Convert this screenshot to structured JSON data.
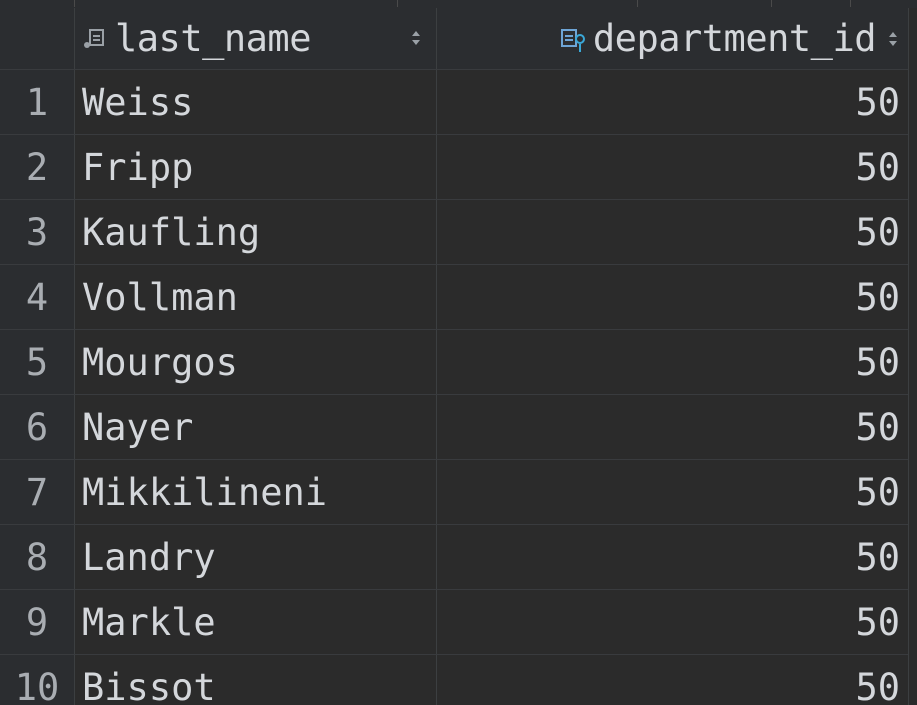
{
  "columns": {
    "last_name": {
      "label": "last_name",
      "icon": "column-icon"
    },
    "department_id": {
      "label": "department_id",
      "icon": "key-column-icon"
    }
  },
  "rows": [
    {
      "num": "1",
      "last_name": "Weiss",
      "department_id": "50"
    },
    {
      "num": "2",
      "last_name": "Fripp",
      "department_id": "50"
    },
    {
      "num": "3",
      "last_name": "Kaufling",
      "department_id": "50"
    },
    {
      "num": "4",
      "last_name": "Vollman",
      "department_id": "50"
    },
    {
      "num": "5",
      "last_name": "Mourgos",
      "department_id": "50"
    },
    {
      "num": "6",
      "last_name": "Nayer",
      "department_id": "50"
    },
    {
      "num": "7",
      "last_name": "Mikkilineni",
      "department_id": "50"
    },
    {
      "num": "8",
      "last_name": "Landry",
      "department_id": "50"
    },
    {
      "num": "9",
      "last_name": "Markle",
      "department_id": "50"
    },
    {
      "num": "10",
      "last_name": "Bissot",
      "department_id": "50"
    }
  ],
  "colors": {
    "background": "#2b2b2b",
    "gutter": "#2b2d30",
    "text": "#d4d7db",
    "key_icon": "#3aa8d8"
  }
}
